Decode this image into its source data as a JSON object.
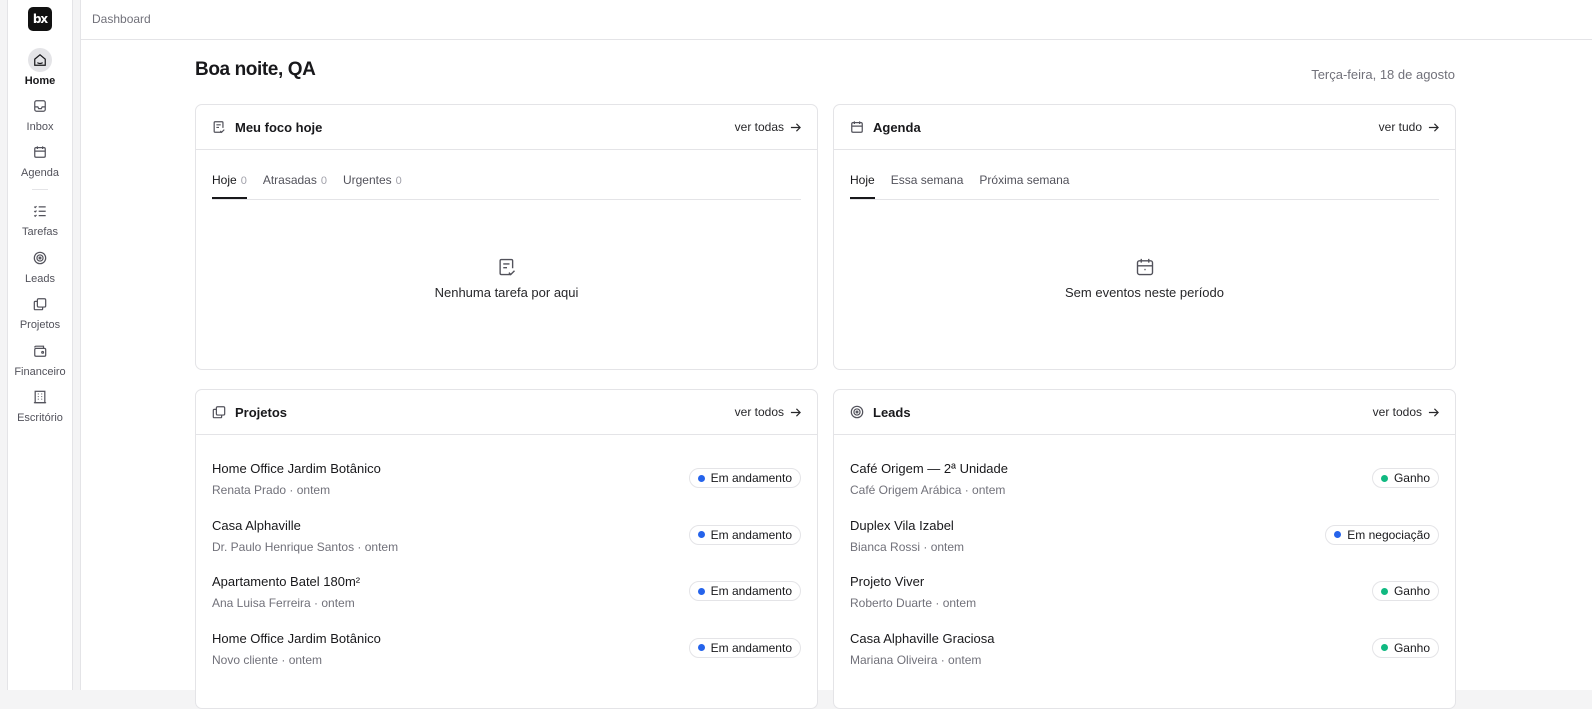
{
  "sidebar": {
    "logo": "bx",
    "items": [
      {
        "label": "Home",
        "icon": "home-icon",
        "active": true
      },
      {
        "label": "Inbox",
        "icon": "inbox-icon",
        "active": false
      },
      {
        "label": "Agenda",
        "icon": "calendar-icon",
        "active": false
      },
      {
        "label": "Tarefas",
        "icon": "checklist-icon",
        "active": false
      },
      {
        "label": "Leads",
        "icon": "target-icon",
        "active": false
      },
      {
        "label": "Projetos",
        "icon": "folders-icon",
        "active": false
      },
      {
        "label": "Financeiro",
        "icon": "wallet-icon",
        "active": false
      },
      {
        "label": "Escritório",
        "icon": "building-icon",
        "active": false
      }
    ]
  },
  "header": {
    "breadcrumb": "Dashboard"
  },
  "greeting": "Boa noite, QA",
  "date": "Terça-feira, 18 de agosto",
  "focus": {
    "title": "Meu foco hoje",
    "link": "ver todas",
    "tabs": [
      {
        "label": "Hoje",
        "count": "0",
        "active": true
      },
      {
        "label": "Atrasadas",
        "count": "0",
        "active": false
      },
      {
        "label": "Urgentes",
        "count": "0",
        "active": false
      }
    ],
    "empty": "Nenhuma tarefa por aqui"
  },
  "agenda": {
    "title": "Agenda",
    "link": "ver tudo",
    "tabs": [
      {
        "label": "Hoje",
        "active": true
      },
      {
        "label": "Essa semana",
        "active": false
      },
      {
        "label": "Próxima semana",
        "active": false
      }
    ],
    "empty": "Sem eventos neste período"
  },
  "projects": {
    "title": "Projetos",
    "link": "ver todos",
    "rows": [
      {
        "title": "Home Office Jardim Botânico",
        "sub": "Renata Prado · ontem",
        "status": "Em andamento",
        "color": "#2563eb"
      },
      {
        "title": "Casa Alphaville",
        "sub": "Dr. Paulo Henrique Santos · ontem",
        "status": "Em andamento",
        "color": "#2563eb"
      },
      {
        "title": "Apartamento Batel 180m²",
        "sub": "Ana Luisa Ferreira · ontem",
        "status": "Em andamento",
        "color": "#2563eb"
      },
      {
        "title": "Home Office Jardim Botânico",
        "sub": "Novo cliente · ontem",
        "status": "Em andamento",
        "color": "#2563eb"
      }
    ]
  },
  "leads": {
    "title": "Leads",
    "link": "ver todos",
    "rows": [
      {
        "title": "Café Origem — 2ª Unidade",
        "sub": "Café Origem Arábica · ontem",
        "status": "Ganho",
        "color": "#10b981"
      },
      {
        "title": "Duplex Vila Izabel",
        "sub": "Bianca Rossi · ontem",
        "status": "Em negociação",
        "color": "#2563eb"
      },
      {
        "title": "Projeto Viver",
        "sub": "Roberto Duarte · ontem",
        "status": "Ganho",
        "color": "#10b981"
      },
      {
        "title": "Casa Alphaville Graciosa",
        "sub": "Mariana Oliveira · ontem",
        "status": "Ganho",
        "color": "#10b981"
      }
    ]
  }
}
